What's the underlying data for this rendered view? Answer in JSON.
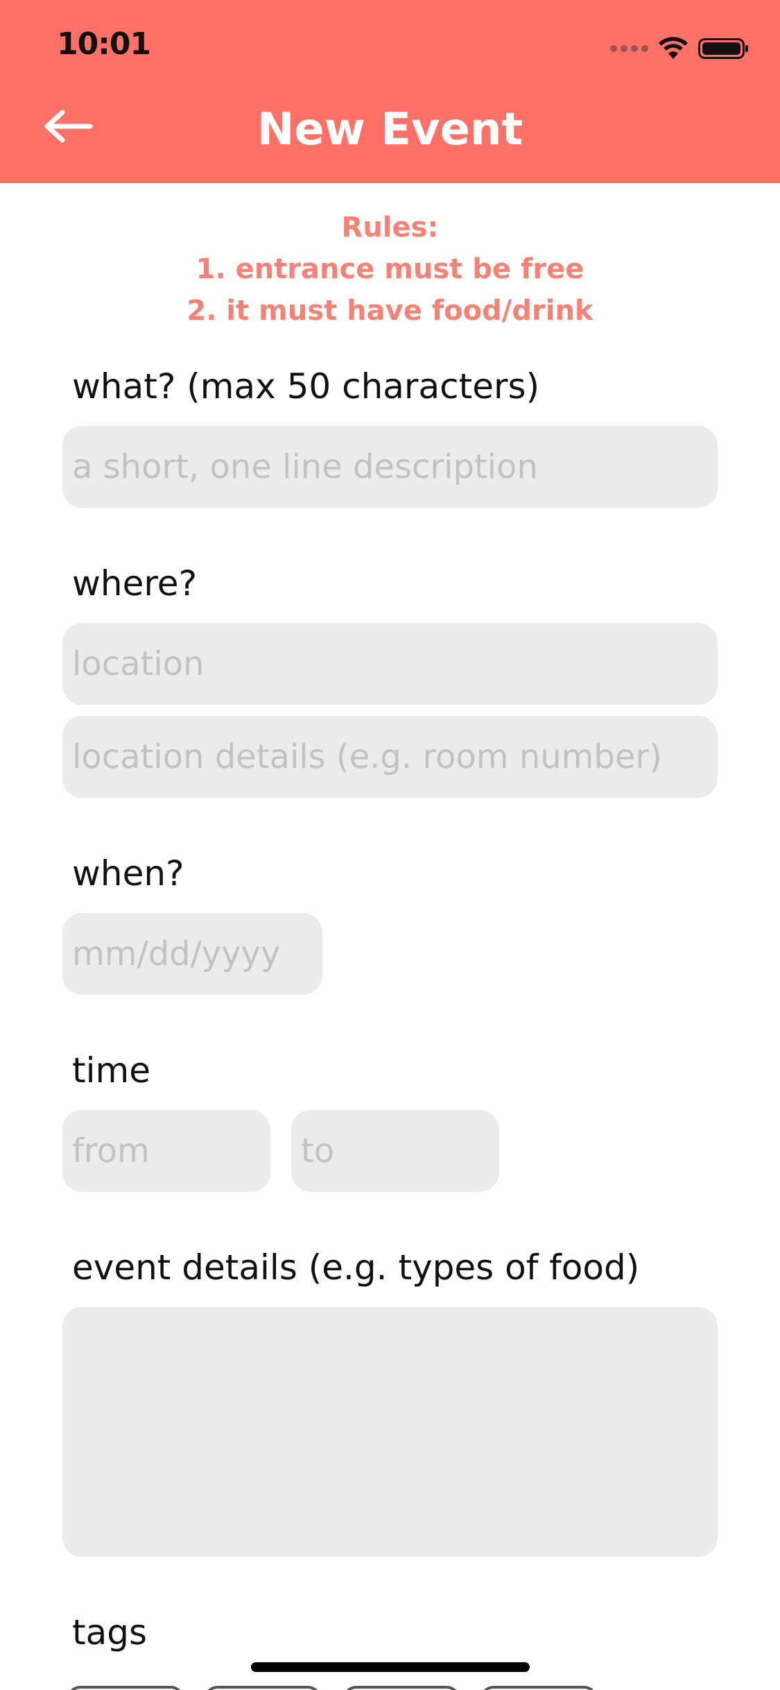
{
  "status_bar": {
    "time": "10:01"
  },
  "header": {
    "title": "New Event",
    "back_icon": "arrow-left-icon",
    "background": "#ff7066"
  },
  "rules": {
    "heading": "Rules:",
    "line1": "1. entrance must be free",
    "line2": "2. it must have food/drink",
    "color": "#f48376"
  },
  "form": {
    "what": {
      "label": "what? (max 50 characters)",
      "placeholder": "a short, one line description"
    },
    "where": {
      "label": "where?",
      "location_placeholder": "location",
      "details_placeholder": "location details (e.g. room number)"
    },
    "when": {
      "label": "when?",
      "date_placeholder": "mm/dd/yyyy"
    },
    "time": {
      "label": "time",
      "from_placeholder": "from",
      "to_placeholder": "to"
    },
    "event_details": {
      "label": "event details (e.g. types of food)"
    },
    "tags": {
      "label": "tags"
    }
  }
}
